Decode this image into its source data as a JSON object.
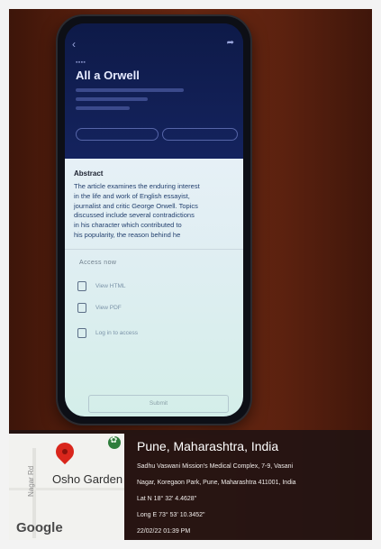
{
  "paper": {
    "title": "All a Orwell",
    "abstract_heading": "Abstract",
    "abstract_lines": [
      "The article examines the enduring interest",
      "in the life and work of English essayist,",
      "journalist and critic George Orwell. Topics",
      "discussed include several contradictions",
      "in his character which contributed to",
      "his popularity, the reason behind he"
    ],
    "access_heading": "Access now",
    "access_items": [
      "View HTML",
      "View PDF",
      "Log in to access"
    ],
    "submit_label": "Submit"
  },
  "map": {
    "place_label": "Osho Garden",
    "side_label": "Nagar Rd",
    "provider": "Google",
    "pin_color": "#d9261c",
    "poi_color": "#2f7d3c"
  },
  "gps": {
    "city": "Pune, Maharashtra, India",
    "address_line1": "Sadhu Vaswani Mission's Medical Complex, 7-9, Vasani",
    "address_line2": "Nagar, Koregaon Park, Pune, Maharashtra 411001, India",
    "lat": "Lat N 18° 32' 4.4628\"",
    "long": "Long E 73° 53' 10.3452\"",
    "datetime": "22/02/22 01:39 PM"
  }
}
